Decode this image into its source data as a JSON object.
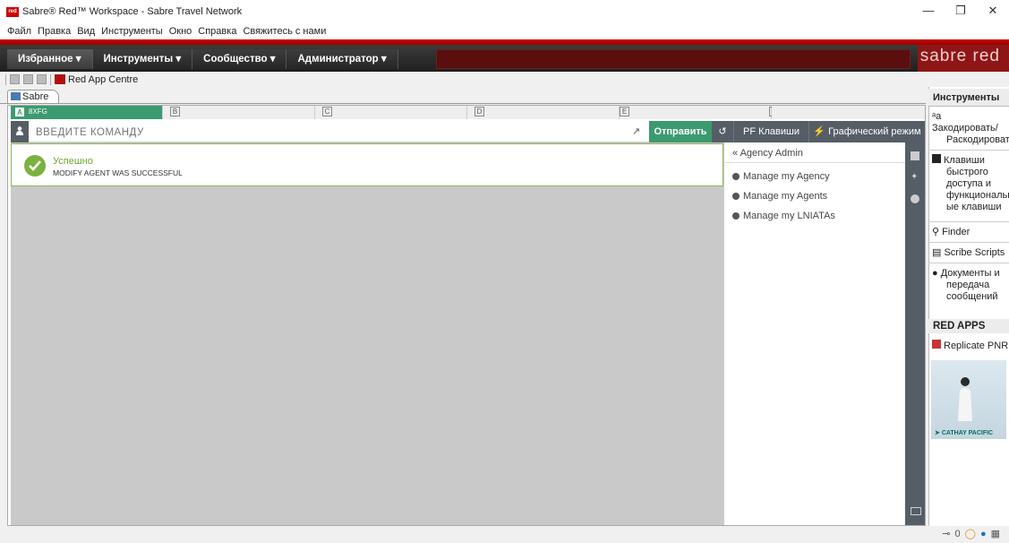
{
  "window": {
    "title": "Sabre® Red™ Workspace - Sabre Travel Network",
    "logo_text": "red",
    "minimize": "—",
    "maximize": "❐",
    "close": "✕"
  },
  "menu": [
    "Файл",
    "Правка",
    "Вид",
    "Инструменты",
    "Окно",
    "Справка",
    "Свяжитесь с нами"
  ],
  "nav": {
    "tabs": [
      "Избранное ▾",
      "Инструменты ▾",
      "Сообщество ▾",
      "Администратор ▾"
    ],
    "brand": "sabre red"
  },
  "toolbar": {
    "red_app_centre": "Red App Centre"
  },
  "doc_tab": "Sabre",
  "work_areas": [
    {
      "letter": "A",
      "label": "8XFG",
      "active": true
    },
    {
      "letter": "B",
      "label": "",
      "active": false
    },
    {
      "letter": "C",
      "label": "",
      "active": false
    },
    {
      "letter": "D",
      "label": "",
      "active": false
    },
    {
      "letter": "E",
      "label": "",
      "active": false
    },
    {
      "letter": "F",
      "label": "",
      "active": false
    }
  ],
  "command": {
    "placeholder": "ВВЕДИТЕ КОМАНДУ",
    "send": "Отправить",
    "pf_keys": "PF Клавиши",
    "graphic_mode": "Графический режим"
  },
  "response": {
    "title": "Успешно",
    "message": "MODIFY AGENT WAS SUCCESSFUL"
  },
  "agency_panel": {
    "header": "« Agency Admin",
    "links": [
      "Manage my Agency",
      "Manage my Agents",
      "Manage my LNIATAs"
    ]
  },
  "tools_sidebar": {
    "header": "Инструменты",
    "encode": "Закодировать/",
    "decode": "Раскодировать",
    "hotkeys": [
      "Клавиши",
      "быстрого",
      "доступа и",
      "функциональн",
      "ые клавиши"
    ],
    "finder": "Finder",
    "scribe": "Scribe Scripts",
    "docs": [
      "Документы и",
      "передача",
      "сообщений"
    ],
    "red_apps_header": "RED APPS",
    "replicate": "Replicate PNR",
    "ad_brand": "CATHAY PACIFIC"
  },
  "status": {
    "count": "0"
  },
  "colors": {
    "accent_green": "#3c9a6f",
    "success_green": "#7ab23f",
    "brand_red": "#cc0000",
    "dark_slate": "#555e66"
  }
}
